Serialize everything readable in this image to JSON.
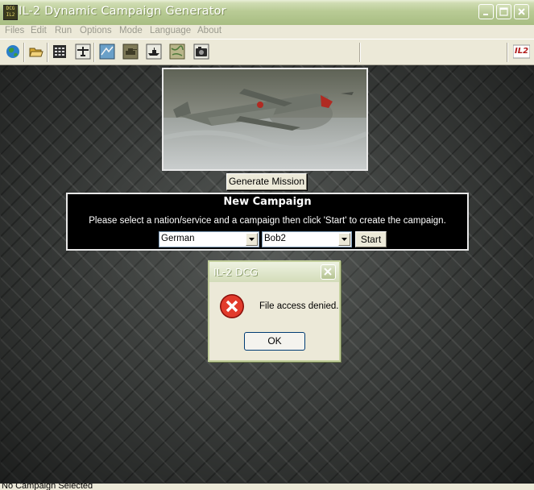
{
  "window": {
    "title": "IL-2 Dynamic Campaign Generator",
    "icon_text": "DCG IL2",
    "buttons": [
      "minimize-icon",
      "maximize-icon",
      "close-icon"
    ]
  },
  "menu": {
    "items": [
      "Files",
      "Edit",
      "Run",
      "Options",
      "Mode",
      "Language",
      "About"
    ]
  },
  "toolbar": {
    "icons": [
      "globe-icon",
      "open-folder-icon",
      "calendar-icon",
      "aircraft-icon",
      "map-icon",
      "tank-icon",
      "ship-icon",
      "satellite-map-icon",
      "camera-icon"
    ],
    "logo_text": "IL2"
  },
  "main": {
    "generate_button": "Generate Mission",
    "campaign_panel": {
      "title": "New Campaign",
      "instructions": "Please select a nation/service and a campaign then click 'Start' to create the campaign.",
      "nation_value": "German",
      "campaign_value": "Bob2",
      "start_label": "Start"
    }
  },
  "dialog": {
    "title": "IL-2 DCG",
    "message": "File access denied.",
    "ok_label": "OK",
    "icon": "error-icon"
  },
  "status": {
    "text": "No Campaign Selected"
  },
  "colors": {
    "title_bar": "#b9cb95",
    "panel_bg": "#000000",
    "error_red": "#d8281c"
  }
}
